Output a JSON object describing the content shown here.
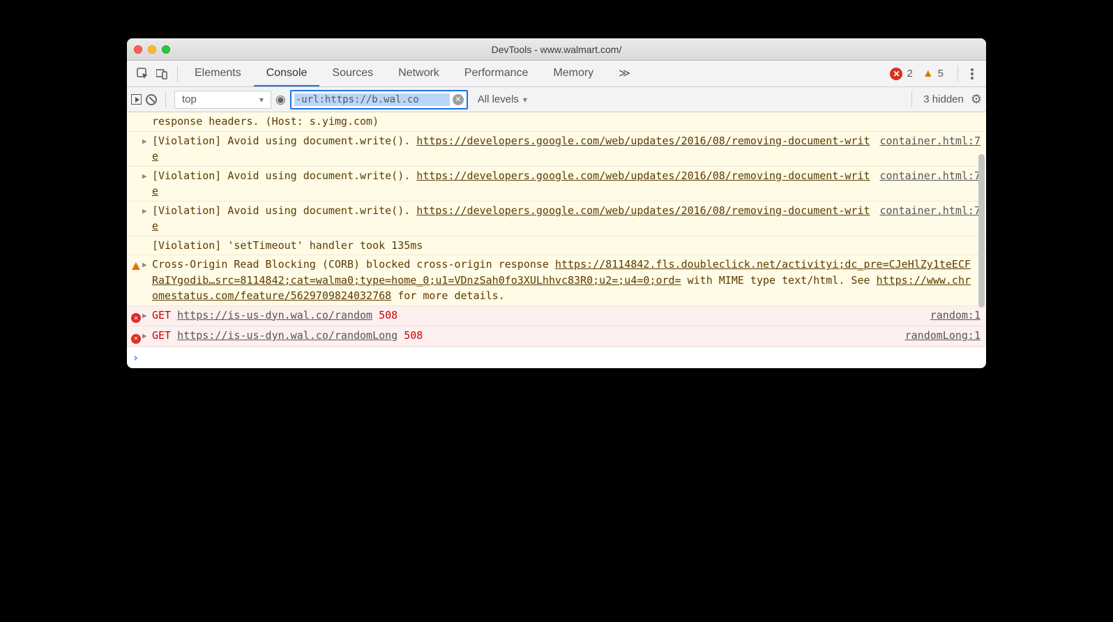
{
  "window": {
    "title": "DevTools - www.walmart.com/"
  },
  "tabs": {
    "items": [
      "Elements",
      "Console",
      "Sources",
      "Network",
      "Performance",
      "Memory"
    ],
    "active_index": 1,
    "errors_count": "2",
    "warnings_count": "5"
  },
  "toolbar": {
    "context": "top",
    "filter_value": "-url:https://b.wal.co",
    "levels_label": "All levels",
    "hidden_label": "3 hidden"
  },
  "console": {
    "rows": [
      {
        "type": "violation",
        "expandable": false,
        "msg_a": "response headers. (Host: s.yimg.com)"
      },
      {
        "type": "violation",
        "expandable": true,
        "msg_a": "[Violation] Avoid using document.write(). ",
        "link": "https://developers.google.com/web/updates/2016/08/removing-document-write",
        "src": "container.html:7"
      },
      {
        "type": "violation",
        "expandable": true,
        "msg_a": "[Violation] Avoid using document.write(). ",
        "link": "https://developers.google.com/web/updates/2016/08/removing-document-write",
        "src": "container.html:7"
      },
      {
        "type": "violation",
        "expandable": true,
        "msg_a": "[Violation] Avoid using document.write(). ",
        "link": "https://developers.google.com/web/updates/2016/08/removing-document-write",
        "src": "container.html:7"
      },
      {
        "type": "violation",
        "expandable": false,
        "msg_a": "[Violation] 'setTimeout' handler took 135ms"
      },
      {
        "type": "warn",
        "expandable": true,
        "msg_a": "Cross-Origin Read Blocking (CORB) blocked cross-origin response ",
        "link": "https://8114842.fls.doubleclick.net/activityi;dc_pre=CJeHlZy1teECFRaIYgodib…src=8114842;cat=walma0;type=home_0;u1=VDnzSah0fo3XULhhvc83R0;u2=;u4=0;ord=",
        "msg_b": " with MIME type text/html. See ",
        "link2": "https://www.chromestatus.com/feature/5629709824032768",
        "msg_c": " for more details."
      },
      {
        "type": "error",
        "expandable": true,
        "method": "GET",
        "url": "https://is-us-dyn.wal.co/random",
        "code": "508",
        "src": "random:1"
      },
      {
        "type": "error",
        "expandable": true,
        "method": "GET",
        "url": "https://is-us-dyn.wal.co/randomLong",
        "code": "508",
        "src": "randomLong:1"
      }
    ]
  }
}
